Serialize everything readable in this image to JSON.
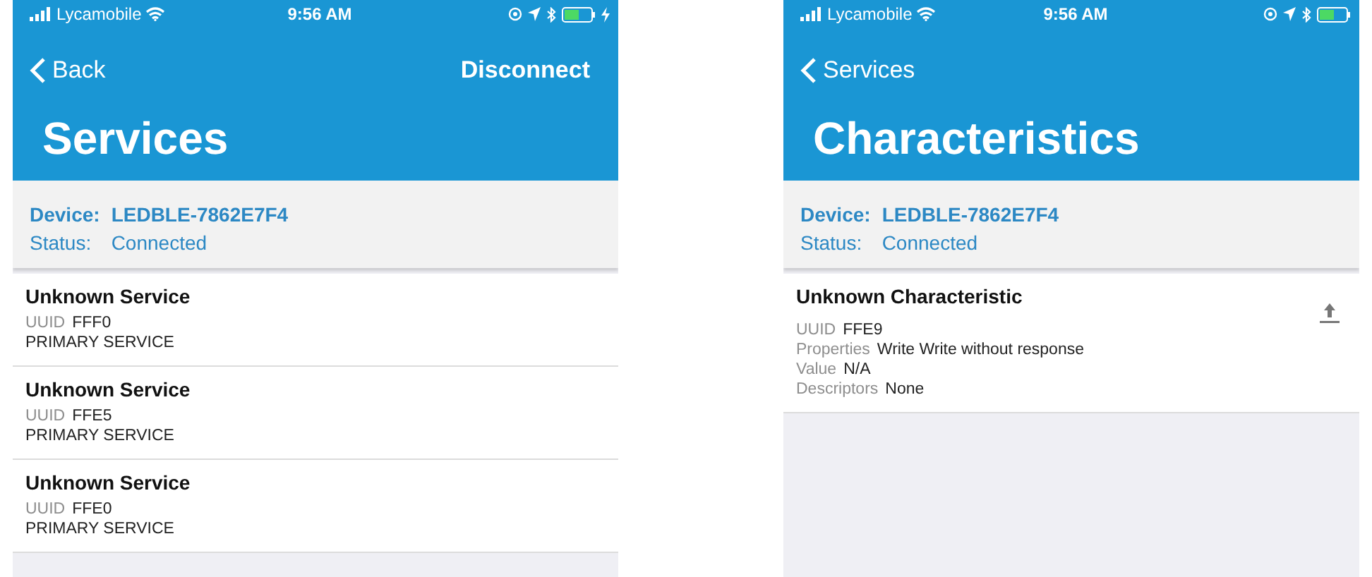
{
  "screens": [
    {
      "status_bar": {
        "carrier": "Lycamobile",
        "time": "9:56 AM",
        "charging": true
      },
      "nav": {
        "back": "Back",
        "action": "Disconnect"
      },
      "title": "Services",
      "device": {
        "device_label": "Device:",
        "device_name": "LEDBLE-7862E7F4",
        "status_label": "Status:",
        "status": "Connected"
      },
      "items": [
        {
          "kind": "service",
          "title": "Unknown Service",
          "fields": [
            {
              "label": "UUID",
              "value": "FFF0"
            }
          ],
          "note": "PRIMARY SERVICE"
        },
        {
          "kind": "service",
          "title": "Unknown Service",
          "fields": [
            {
              "label": "UUID",
              "value": "FFE5"
            }
          ],
          "note": "PRIMARY SERVICE"
        },
        {
          "kind": "service",
          "title": "Unknown Service",
          "fields": [
            {
              "label": "UUID",
              "value": "FFE0"
            }
          ],
          "note": "PRIMARY SERVICE"
        }
      ]
    },
    {
      "status_bar": {
        "carrier": "Lycamobile",
        "time": "9:56 AM",
        "charging": false
      },
      "nav": {
        "back": "Services"
      },
      "title": "Characteristics",
      "device": {
        "device_label": "Device:",
        "device_name": "LEDBLE-7862E7F4",
        "status_label": "Status:",
        "status": "Connected"
      },
      "items": [
        {
          "kind": "characteristic",
          "title": "Unknown Characteristic",
          "fields": [
            {
              "label": "UUID",
              "value": "FFE9"
            },
            {
              "label": "Properties",
              "value": "Write Write without response"
            },
            {
              "label": "Value",
              "value": "N/A"
            },
            {
              "label": "Descriptors",
              "value": "None"
            }
          ]
        }
      ]
    }
  ]
}
